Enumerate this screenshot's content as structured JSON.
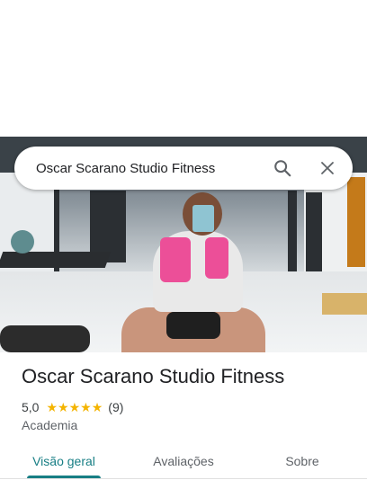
{
  "search": {
    "query": "Oscar Scarano Studio Fitness"
  },
  "place": {
    "name": "Oscar Scarano Studio Fitness",
    "rating": "5,0",
    "stars": 5,
    "review_count": "(9)",
    "category": "Academia"
  },
  "tabs": [
    {
      "label": "Visão geral",
      "active": true
    },
    {
      "label": "Avaliações",
      "active": false
    },
    {
      "label": "Sobre",
      "active": false
    }
  ],
  "colors": {
    "accent": "#177e84",
    "star": "#f4b400"
  },
  "icons": {
    "search": "search-icon",
    "close": "close-icon",
    "star": "star-icon"
  }
}
